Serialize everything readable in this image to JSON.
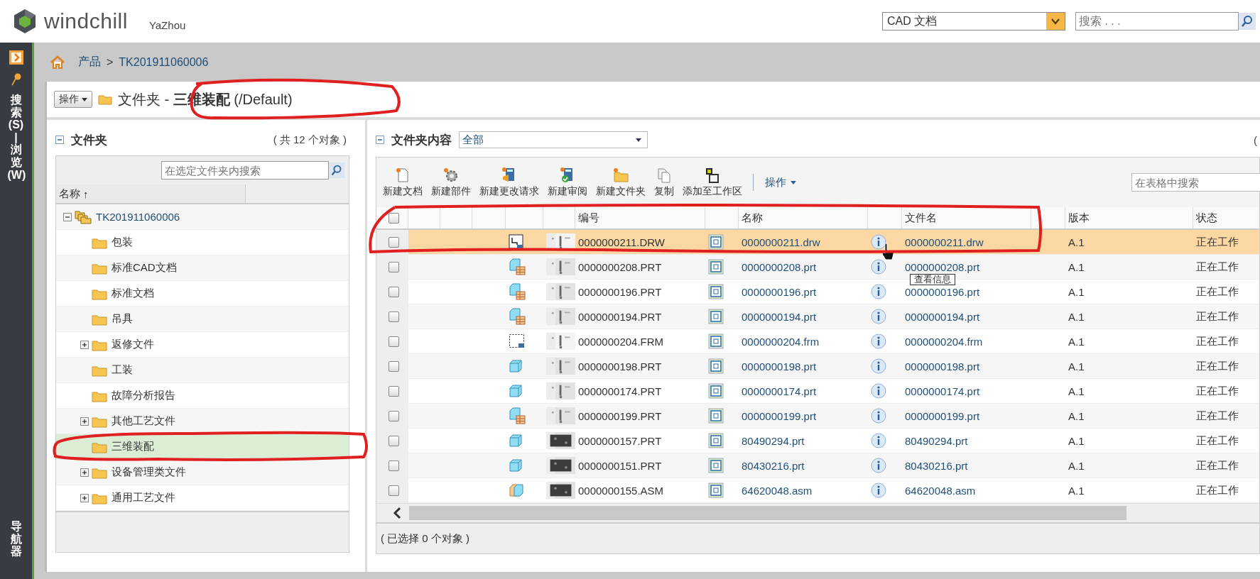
{
  "header": {
    "logo": "windchill",
    "user": "YaZhou",
    "type_select": "CAD 文档",
    "search": {
      "placeholder": "搜索 . . ."
    }
  },
  "side_rail": {
    "tabs": [
      {
        "label": "搜索(S) | 浏览(W)"
      },
      {
        "label": "导航器"
      }
    ]
  },
  "breadcrumb": {
    "items": [
      "产品",
      "TK201911060006"
    ],
    "separator": ">"
  },
  "page_title": {
    "actions": "操作",
    "text": "文件夹 - **三维装配** (/Default)"
  },
  "folder_panel": {
    "title": "文件夹",
    "count": "( 共 12 个对象 )",
    "search": {
      "placeholder": "在选定文件夹内搜索"
    },
    "column": "名称",
    "sort_mark": "↑",
    "tree": [
      {
        "label": "TK201911060006",
        "kind": "product",
        "expandable": true,
        "expanded": true,
        "selected": false,
        "children": [
          {
            "label": "包装",
            "kind": "folder",
            "expandable": false,
            "selected": false
          },
          {
            "label": "标准CAD文档",
            "kind": "folder",
            "expandable": false,
            "selected": false
          },
          {
            "label": "标准文档",
            "kind": "folder",
            "expandable": false,
            "selected": false
          },
          {
            "label": "吊具",
            "kind": "folder",
            "expandable": false,
            "selected": false
          },
          {
            "label": "返修文件",
            "kind": "folder",
            "expandable": true,
            "expanded": false,
            "selected": false
          },
          {
            "label": "工装",
            "kind": "folder",
            "expandable": false,
            "selected": false
          },
          {
            "label": "故障分析报告",
            "kind": "folder",
            "expandable": false,
            "selected": false
          },
          {
            "label": "其他工艺文件",
            "kind": "folder",
            "expandable": true,
            "expanded": false,
            "selected": false
          },
          {
            "label": "三维装配",
            "kind": "folder",
            "expandable": false,
            "selected": true
          },
          {
            "label": "设备管理类文件",
            "kind": "folder",
            "expandable": true,
            "expanded": false,
            "selected": false
          },
          {
            "label": "通用工艺文件",
            "kind": "folder",
            "expandable": true,
            "expanded": false,
            "selected": false
          }
        ]
      }
    ]
  },
  "content_panel": {
    "title": "文件夹内容",
    "filter": "全部",
    "count": "(",
    "toolbar": [
      {
        "label": "新建文档",
        "kind": "new_document"
      },
      {
        "label": "新建部件",
        "kind": "new_part"
      },
      {
        "label": "新建更改请求",
        "kind": "change_request"
      },
      {
        "label": "新建审阅",
        "kind": "review"
      },
      {
        "label": "新建文件夹",
        "kind": "new_folder"
      },
      {
        "label": "复制",
        "kind": "copy"
      },
      {
        "label": "添加至工作区",
        "kind": "workspace"
      }
    ],
    "actions_menu": "操作",
    "table_search": {
      "placeholder": "在表格中搜索"
    },
    "table": {
      "select_all": {
        "checked": false
      },
      "columns": [
        "编号",
        "名称",
        "文件名",
        "版本",
        "状态"
      ],
      "rows": [
        {
          "checked": false,
          "selected": true,
          "kind": "drawing",
          "number": "0000000211.DRW",
          "name": "0000000211.drw",
          "file": "0000000211.drw",
          "version": "A.1",
          "state": "正在工作"
        },
        {
          "checked": false,
          "selected": false,
          "kind": "part_table",
          "number": "0000000208.PRT",
          "name": "0000000208.prt",
          "file": "0000000208.prt",
          "version": "A.1",
          "state": "正在工作"
        },
        {
          "checked": false,
          "selected": false,
          "kind": "part_table",
          "number": "0000000196.PRT",
          "name": "0000000196.prt",
          "file": "0000000196.prt",
          "version": "A.1",
          "state": "正在工作"
        },
        {
          "checked": false,
          "selected": false,
          "kind": "part_table",
          "number": "0000000194.PRT",
          "name": "0000000194.prt",
          "file": "0000000194.prt",
          "version": "A.1",
          "state": "正在工作"
        },
        {
          "checked": false,
          "selected": false,
          "kind": "format",
          "number": "0000000204.FRM",
          "name": "0000000204.frm",
          "file": "0000000204.frm",
          "version": "A.1",
          "state": "正在工作"
        },
        {
          "checked": false,
          "selected": false,
          "kind": "part",
          "number": "0000000198.PRT",
          "name": "0000000198.prt",
          "file": "0000000198.prt",
          "version": "A.1",
          "state": "正在工作"
        },
        {
          "checked": false,
          "selected": false,
          "kind": "part",
          "number": "0000000174.PRT",
          "name": "0000000174.prt",
          "file": "0000000174.prt",
          "version": "A.1",
          "state": "正在工作"
        },
        {
          "checked": false,
          "selected": false,
          "kind": "part_table",
          "number": "0000000199.PRT",
          "name": "0000000199.prt",
          "file": "0000000199.prt",
          "version": "A.1",
          "state": "正在工作"
        },
        {
          "checked": false,
          "selected": false,
          "kind": "part",
          "number": "0000000157.PRT",
          "name": "80490294.prt",
          "file": "80490294.prt",
          "version": "A.1",
          "state": "正在工作"
        },
        {
          "checked": false,
          "selected": false,
          "kind": "part",
          "number": "0000000151.PRT",
          "name": "80430216.prt",
          "file": "80430216.prt",
          "version": "A.1",
          "state": "正在工作"
        },
        {
          "checked": false,
          "selected": false,
          "kind": "assembly",
          "number": "0000000155.ASM",
          "name": "64620048.asm",
          "file": "64620048.asm",
          "version": "A.1",
          "state": "正在工作"
        }
      ]
    },
    "tooltip": "查看信息",
    "footer": "( 已选择 0 个对象 )"
  }
}
